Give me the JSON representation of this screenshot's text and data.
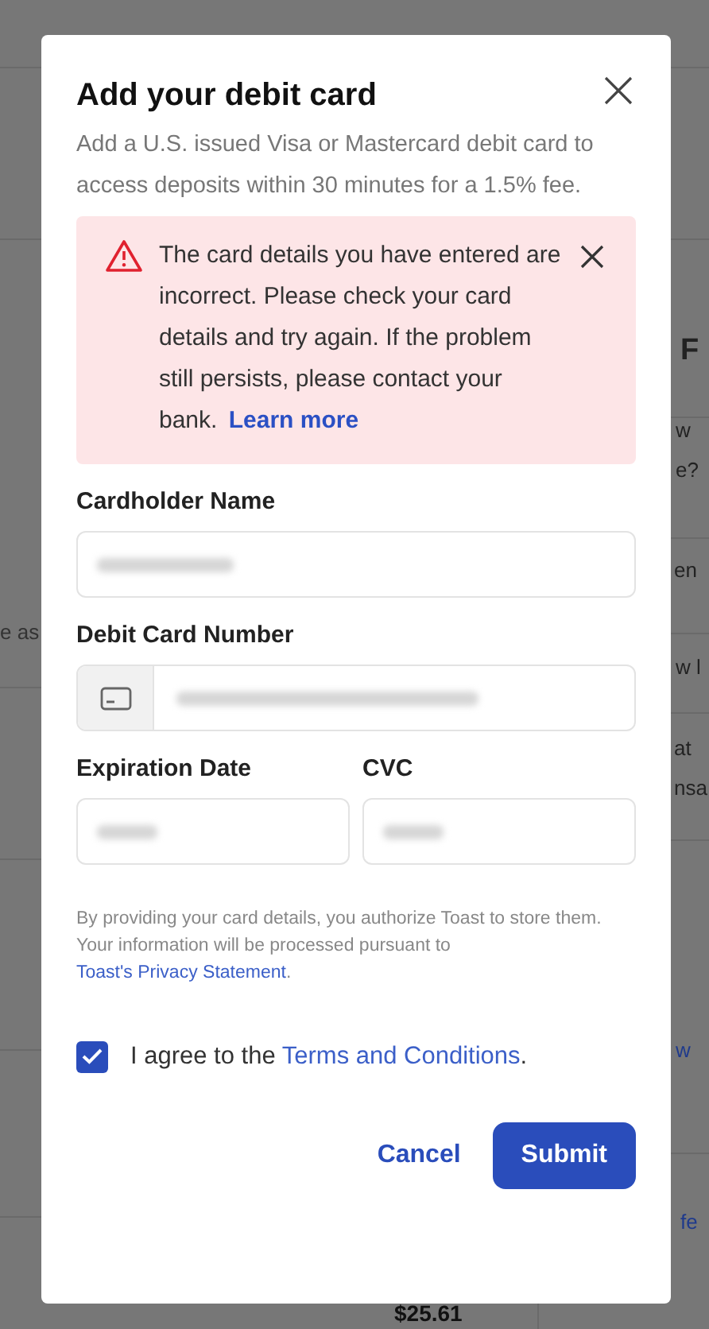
{
  "background": {
    "fragments": [
      {
        "text": "F",
        "kind": "heading"
      },
      {
        "text": "w",
        "kind": "text"
      },
      {
        "text": "e?",
        "kind": "text"
      },
      {
        "text": "en",
        "kind": "text"
      },
      {
        "text": "w l",
        "kind": "text"
      },
      {
        "text": "at",
        "kind": "text"
      },
      {
        "text": "nsa",
        "kind": "text"
      },
      {
        "text": "w",
        "kind": "link"
      },
      {
        "text": "fe",
        "kind": "link"
      },
      {
        "text": "e as",
        "kind": "left"
      },
      {
        "text": "$25.61",
        "kind": "amount"
      }
    ]
  },
  "modal": {
    "title": "Add your debit card",
    "description": "Add a U.S. issued Visa or Mastercard debit card to access deposits within 30 minutes for a 1.5% fee.",
    "alert": {
      "message": "The card details you have entered are incorrect. Please check your card details and try again. If the problem still persists, please contact your bank.",
      "link": "Learn more"
    },
    "fields": [
      {
        "label": "Cardholder Name",
        "kind": "text"
      },
      {
        "label": "Debit Card Number",
        "kind": "card"
      },
      {
        "label": "Expiration Date",
        "kind": "half"
      },
      {
        "label": "CVC",
        "kind": "half"
      }
    ],
    "disclaimer": {
      "text": "By providing your card details, you authorize Toast to store them. Your information will be processed pursuant to",
      "link": "Toast's Privacy Statement",
      "end": "."
    },
    "agreement": {
      "checked": true,
      "text": "I agree to the",
      "link": "Terms and Conditions",
      "end": "."
    },
    "buttons": [
      {
        "label": "Cancel",
        "kind": "secondary"
      },
      {
        "label": "Submit",
        "kind": "primary"
      }
    ]
  }
}
